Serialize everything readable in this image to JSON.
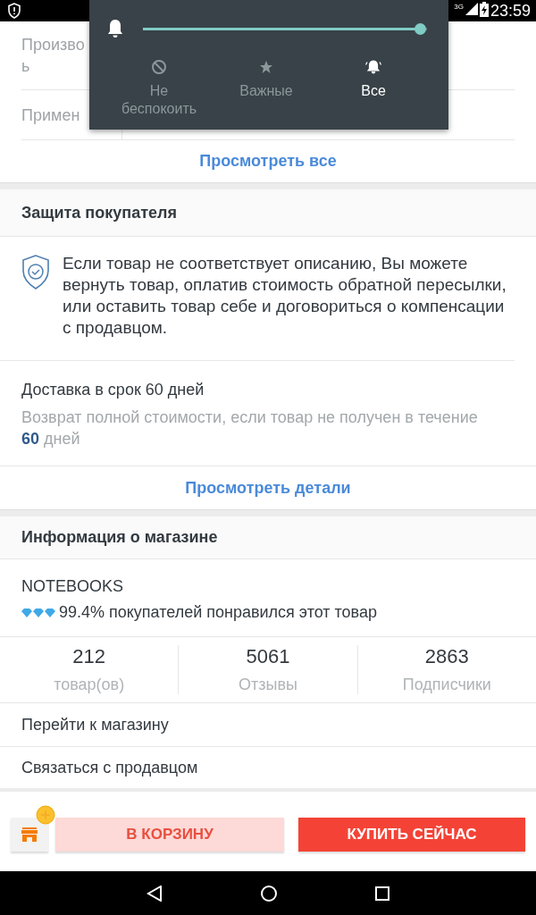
{
  "status_bar": {
    "network": "3G",
    "time": "23:59"
  },
  "volume_panel": {
    "level": 1,
    "modes": [
      {
        "label": "Не беспокоить",
        "kind": "block",
        "selected": false
      },
      {
        "label": "Важные",
        "kind": "star",
        "selected": false
      },
      {
        "label": "Все",
        "kind": "bell",
        "selected": true
      }
    ]
  },
  "specs": {
    "rows": [
      {
        "label": "Произво\nь"
      },
      {
        "label": "Примен"
      }
    ],
    "link": "Просмотреть все"
  },
  "protection": {
    "title": "Защита покупателя",
    "text": "Если товар не соответствует описанию, Вы можете вернуть товар, оплатив стоимость обратной пересылки, или оставить товар себе и договориться о компенсации с продавцом.",
    "delivery_title": "Доставка в срок 60 дней",
    "delivery_text": "Возврат полной стоимости, если товар не получен в течение **60** дней",
    "link": "Просмотреть детали"
  },
  "store": {
    "title": "Информация о магазине",
    "name": "NOTEBOOKS",
    "rating": "99.4% покупателей понравился этот товар",
    "stats": [
      {
        "value": "212",
        "label": "товар(ов)"
      },
      {
        "value": "5061",
        "label": "Отзывы"
      },
      {
        "value": "2863",
        "label": "Подписчики"
      }
    ],
    "actions": [
      "Перейти к магазину",
      "Связаться с продавцом"
    ]
  },
  "bottom_bar": {
    "cart": "В КОРЗИНУ",
    "buy": "КУПИТЬ СЕЙЧАС"
  }
}
